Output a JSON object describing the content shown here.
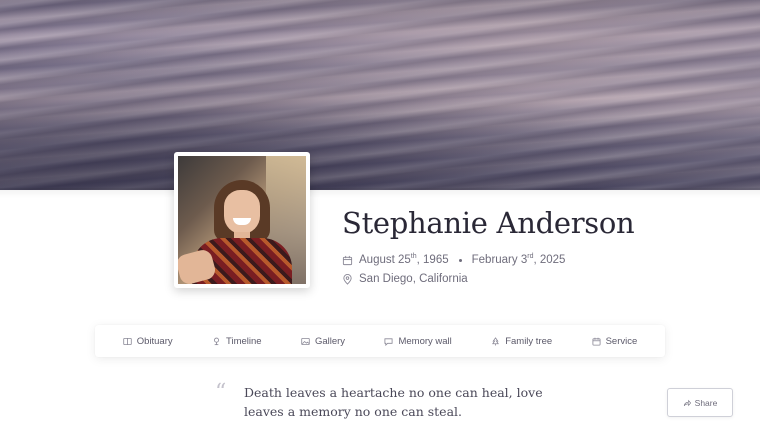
{
  "profile": {
    "name": "Stephanie Anderson",
    "birth_month_day": "August 25",
    "birth_suffix": "th",
    "birth_year": ", 1965",
    "death_month_day": "February 3",
    "death_suffix": "rd",
    "death_year": ", 2025",
    "location": "San Diego, California"
  },
  "nav": {
    "items": [
      {
        "label": "Obituary",
        "icon": "book-icon"
      },
      {
        "label": "Timeline",
        "icon": "timeline-icon"
      },
      {
        "label": "Gallery",
        "icon": "image-icon"
      },
      {
        "label": "Memory wall",
        "icon": "chat-icon"
      },
      {
        "label": "Family tree",
        "icon": "tree-icon"
      },
      {
        "label": "Service",
        "icon": "calendar-icon"
      }
    ]
  },
  "quote": {
    "mark": "“",
    "text": "Death leaves a heartache no one can heal, love leaves a memory no one can steal."
  },
  "share": {
    "label": "Share"
  }
}
